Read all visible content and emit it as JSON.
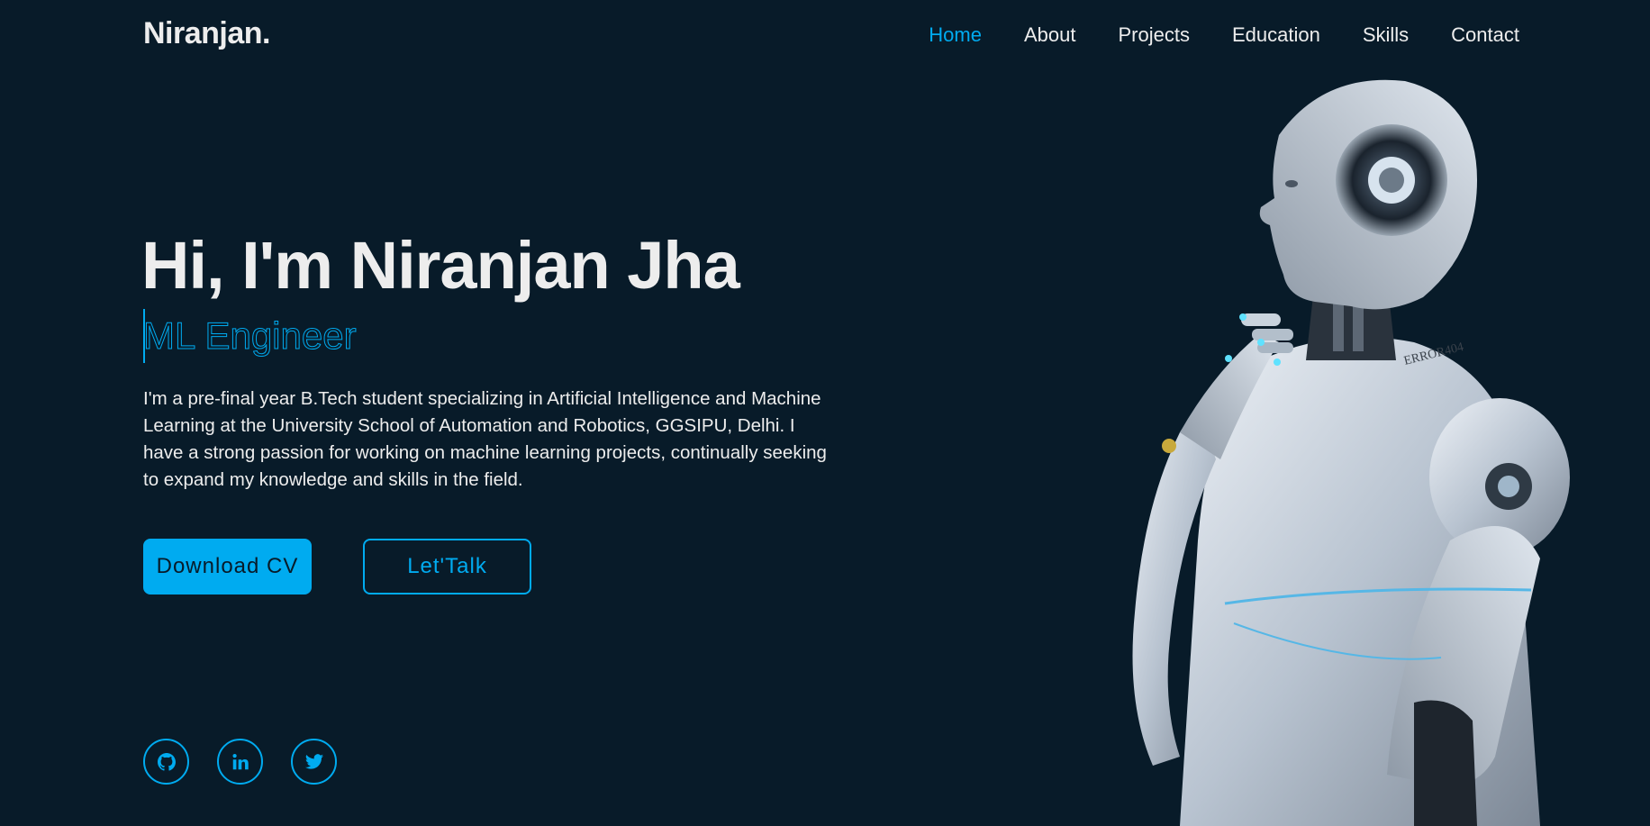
{
  "header": {
    "logo": "Niranjan.",
    "nav": [
      {
        "label": "Home",
        "active": true
      },
      {
        "label": "About"
      },
      {
        "label": "Projects"
      },
      {
        "label": "Education"
      },
      {
        "label": "Skills"
      },
      {
        "label": "Contact"
      }
    ]
  },
  "hero": {
    "title": "Hi, I'm Niranjan Jha",
    "role": "ML Engineer",
    "description": "I'm a pre-final year B.Tech student specializing in Artificial Intelligence and Machine Learning at the University School of Automation and Robotics, GGSIPU, Delhi. I have a strong passion for working on machine learning projects, continually seeking to expand my knowledge and skills in the field.",
    "primary_button": "Download CV",
    "secondary_button": "Let'Talk"
  },
  "social": [
    {
      "icon": "github-icon"
    },
    {
      "icon": "linkedin-icon"
    },
    {
      "icon": "twitter-icon"
    }
  ],
  "robot_label": "ERROR404",
  "colors": {
    "background": "#081b29",
    "accent": "#00abf0",
    "text": "#ededed"
  }
}
